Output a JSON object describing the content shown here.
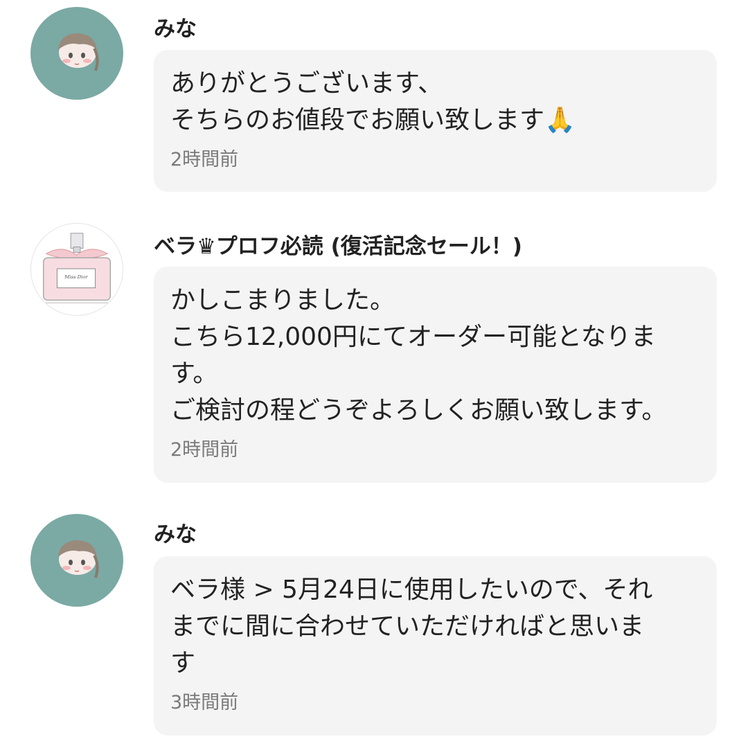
{
  "comments": [
    {
      "author": "みな",
      "lines": [
        "ありがとうございます、",
        "そちらのお値段でお願い致します"
      ],
      "emoji": "🙏",
      "time": "2時間前"
    },
    {
      "author": "ベラ♛プロフ必読 (復活記念セール！)",
      "lines": [
        "かしこまりました。",
        "こちら12,000円にてオーダー可能となりま",
        "す。",
        "ご検討の程どうぞよろしくお願い致します。"
      ],
      "time": "2時間前"
    },
    {
      "author": "みな",
      "lines": [
        "ベラ様 > 5月24日に使用したいので、それ",
        "までに間に合わせていただければと思いま",
        "す"
      ],
      "time": "3時間前"
    }
  ],
  "icons": {
    "avatar_1": "anime-girl-avatar-icon",
    "avatar_2": "perfume-bottle-avatar-icon",
    "avatar_3": "anime-girl-avatar-icon"
  },
  "colors": {
    "avatar_bg": "#7ba9a4",
    "bubble_bg": "#f4f4f4",
    "time_text": "#7a7a7a"
  }
}
